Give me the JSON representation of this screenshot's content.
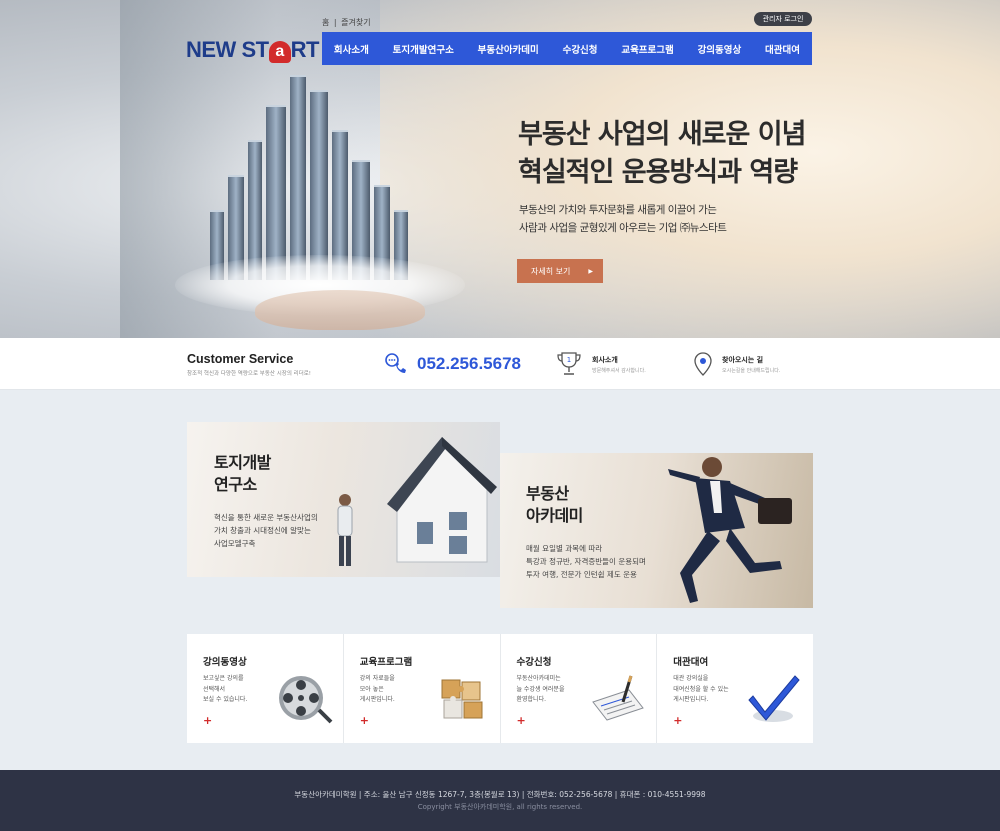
{
  "header": {
    "logo": {
      "part1": "NEW ST",
      "part2": "a",
      "part3": "RT"
    },
    "top_links": [
      "홈",
      "즐겨찾기"
    ],
    "top_sep": "|",
    "admin_login": "관리자 로그인",
    "nav": [
      "회사소개",
      "토지개발연구소",
      "부동산아카데미",
      "수강신청",
      "교육프로그램",
      "강의동영상",
      "대관대여"
    ]
  },
  "hero": {
    "title_line1": "부동산 사업의 새로운 이념",
    "title_line2": "혁실적인 운용방식과 역량",
    "desc_line1": "부동산의 가치와 투자문화를 새롭게 이끌어 가는",
    "desc_line2": "사람과 사업을 균형있게 아우르는 기업 ㈜뉴스타트",
    "cta_label": "자세히 보기",
    "cta_arrow": "▶"
  },
  "customer_service": {
    "title": "Customer Service",
    "subtitle": "창조적 혁신과 다양한 역량으로 부동산 시장의 리더로!",
    "phone": "052.256.5678",
    "items": [
      {
        "label": "회사소개",
        "desc": "방문해주셔서 감사합니다.",
        "icon": "trophy-icon"
      },
      {
        "label": "찾아오시는 길",
        "desc": "오시는길을 안내해드립니다.",
        "icon": "location-pin-icon"
      }
    ]
  },
  "features": [
    {
      "title_line1": "토지개발",
      "title_line2": "연구소",
      "desc_line1": "혁신을 통한 새로운 부동산사업의",
      "desc_line2": "가치 창출과 시대정신에 알맞는",
      "desc_line3": "사업모델구축"
    },
    {
      "title_line1": "부동산",
      "title_line2": "아카데미",
      "desc_line1": "매월 요일별 과목에 따라",
      "desc_line2": "특강과 정규반, 자격증반들이 운용되며",
      "desc_line3": "투자 여행, 전문가 인턴쉽 제도 운용"
    }
  ],
  "cards": [
    {
      "title": "강의동영상",
      "desc_line1": "보고싶은 강의를",
      "desc_line2": "선택해서",
      "desc_line3": "보실 수 있습니다.",
      "plus": "+",
      "icon": "film-reel-icon"
    },
    {
      "title": "교육프로그램",
      "desc_line1": "강의 자료들을",
      "desc_line2": "모아 놓은",
      "desc_line3": "게시판입니다.",
      "plus": "+",
      "icon": "puzzle-icon"
    },
    {
      "title": "수강신청",
      "desc_line1": "부동산아카데미는",
      "desc_line2": "늘 수강생 여러분을",
      "desc_line3": "환영합니다.",
      "plus": "+",
      "icon": "clipboard-pen-icon"
    },
    {
      "title": "대관대여",
      "desc_line1": "대관 강의실을",
      "desc_line2": "대여신청을 할 수 있는",
      "desc_line3": "게시판입니다.",
      "plus": "+",
      "icon": "checkmark-icon"
    }
  ],
  "footer": {
    "line1": "부동산아카데미학원  |  주소: 울산 남구 신정동 1267-7, 3층(봉월로 13)  |  전화번호: 052-256-5678  |  휴대폰 : 010-4551-9998",
    "line2": "Copyright 부동산아카데미학원, all rights reserved."
  },
  "colors": {
    "brand_blue": "#2e58d8",
    "accent_orange": "#c8724f",
    "logo_red": "#d22b2b",
    "footer_bg": "#2e3345"
  }
}
